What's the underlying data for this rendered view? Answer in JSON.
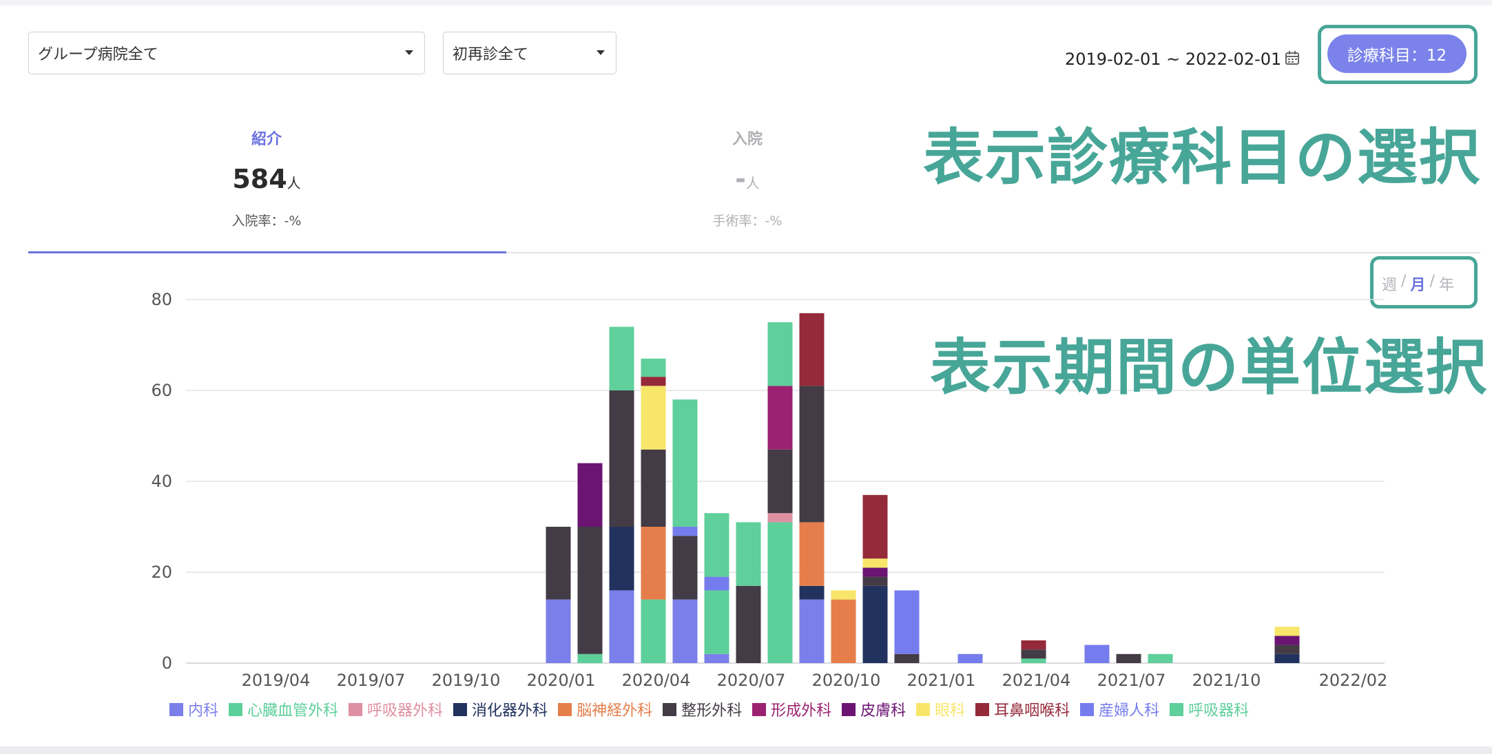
{
  "filters": {
    "hospital": "グループ病院全て",
    "visit_type": "初再診全て"
  },
  "date_range": "2019-02-01 ~ 2022-02-01",
  "dept_button": "診療科目：12",
  "annotations": {
    "dept_select": "表示診療科目の選択",
    "period_select": "表示期間の単位選択"
  },
  "stats": {
    "referral": {
      "label": "紹介",
      "value": "584",
      "unit": "人",
      "rate": "入院率：-%"
    },
    "admission": {
      "label": "入院",
      "value": "-",
      "unit": "人",
      "rate": "手術率：-%"
    }
  },
  "period_toggle": {
    "week": "週",
    "month": "月",
    "year": "年",
    "separator": "/",
    "active": "month"
  },
  "chart_data": {
    "type": "bar",
    "stacked": true,
    "ylim": [
      0,
      80
    ],
    "yticks": [
      0,
      20,
      40,
      60,
      80
    ],
    "grid": true,
    "legend_position": "bottom",
    "x_tick_labels": [
      "2019/04",
      "2019/07",
      "2019/10",
      "2020/01",
      "2020/04",
      "2020/07",
      "2020/10",
      "2021/01",
      "2021/04",
      "2021/07",
      "2021/10",
      "2022/02"
    ],
    "months": [
      "2019/02",
      "2019/03",
      "2019/04",
      "2019/05",
      "2019/06",
      "2019/07",
      "2019/08",
      "2019/09",
      "2019/10",
      "2019/11",
      "2019/12",
      "2020/01",
      "2020/02",
      "2020/03",
      "2020/04",
      "2020/05",
      "2020/06",
      "2020/07",
      "2020/08",
      "2020/09",
      "2020/10",
      "2020/11",
      "2020/12",
      "2021/01",
      "2021/02",
      "2021/03",
      "2021/04",
      "2021/05",
      "2021/06",
      "2021/07",
      "2021/08",
      "2021/09",
      "2021/10",
      "2021/11",
      "2021/12",
      "2022/01",
      "2022/02"
    ],
    "series": [
      {
        "name": "内科",
        "color": "#7b7fea",
        "values": [
          0,
          0,
          0,
          0,
          0,
          0,
          0,
          0,
          0,
          0,
          0,
          14,
          0,
          16,
          0,
          14,
          2,
          0,
          0,
          14,
          0,
          0,
          0,
          0,
          0,
          0,
          0,
          0,
          0,
          0,
          0,
          0,
          0,
          0,
          0,
          0,
          0
        ]
      },
      {
        "name": "心臓血管外科",
        "color": "#5ccf9a",
        "values": [
          0,
          0,
          0,
          0,
          0,
          0,
          0,
          0,
          0,
          0,
          0,
          0,
          2,
          0,
          14,
          0,
          14,
          0,
          31,
          0,
          0,
          0,
          0,
          0,
          0,
          0,
          1,
          0,
          0,
          0,
          0,
          0,
          0,
          0,
          0,
          0,
          0
        ]
      },
      {
        "name": "呼吸器外科",
        "color": "#df8fa2",
        "values": [
          0,
          0,
          0,
          0,
          0,
          0,
          0,
          0,
          0,
          0,
          0,
          0,
          0,
          0,
          0,
          0,
          0,
          0,
          2,
          0,
          0,
          0,
          0,
          0,
          0,
          0,
          0,
          0,
          0,
          0,
          0,
          0,
          0,
          0,
          0,
          0,
          0
        ]
      },
      {
        "name": "消化器外科",
        "color": "#22325e",
        "values": [
          0,
          0,
          0,
          0,
          0,
          0,
          0,
          0,
          0,
          0,
          0,
          0,
          0,
          14,
          0,
          0,
          0,
          0,
          0,
          3,
          0,
          17,
          0,
          0,
          0,
          0,
          0,
          0,
          0,
          0,
          0,
          0,
          0,
          0,
          2,
          0,
          0
        ]
      },
      {
        "name": "脳神経外科",
        "color": "#e57e4a",
        "values": [
          0,
          0,
          0,
          0,
          0,
          0,
          0,
          0,
          0,
          0,
          0,
          0,
          0,
          0,
          16,
          0,
          0,
          0,
          0,
          14,
          14,
          0,
          0,
          0,
          0,
          0,
          0,
          0,
          0,
          0,
          0,
          0,
          0,
          0,
          0,
          0,
          0
        ]
      },
      {
        "name": "整形外科",
        "color": "#433b45",
        "values": [
          0,
          0,
          0,
          0,
          0,
          0,
          0,
          0,
          0,
          0,
          0,
          16,
          28,
          30,
          17,
          14,
          0,
          17,
          14,
          30,
          0,
          2,
          2,
          0,
          0,
          0,
          2,
          0,
          0,
          2,
          0,
          0,
          0,
          0,
          2,
          0,
          0
        ]
      },
      {
        "name": "形成外科",
        "color": "#9b2270",
        "values": [
          0,
          0,
          0,
          0,
          0,
          0,
          0,
          0,
          0,
          0,
          0,
          0,
          0,
          0,
          0,
          0,
          0,
          0,
          14,
          0,
          0,
          0,
          0,
          0,
          0,
          0,
          0,
          0,
          0,
          0,
          0,
          0,
          0,
          0,
          0,
          0,
          0
        ]
      },
      {
        "name": "皮膚科",
        "color": "#6b1472",
        "values": [
          0,
          0,
          0,
          0,
          0,
          0,
          0,
          0,
          0,
          0,
          0,
          0,
          14,
          0,
          0,
          0,
          0,
          0,
          0,
          0,
          0,
          2,
          0,
          0,
          0,
          0,
          0,
          0,
          0,
          0,
          0,
          0,
          0,
          0,
          2,
          0,
          0
        ]
      },
      {
        "name": "眼科",
        "color": "#f7e66a",
        "values": [
          0,
          0,
          0,
          0,
          0,
          0,
          0,
          0,
          0,
          0,
          0,
          0,
          0,
          0,
          14,
          0,
          0,
          0,
          0,
          0,
          2,
          2,
          0,
          0,
          0,
          0,
          0,
          0,
          0,
          0,
          0,
          0,
          0,
          0,
          2,
          0,
          0
        ]
      },
      {
        "name": "耳鼻咽喉科",
        "color": "#952a3a",
        "values": [
          0,
          0,
          0,
          0,
          0,
          0,
          0,
          0,
          0,
          0,
          0,
          0,
          0,
          0,
          2,
          0,
          0,
          0,
          0,
          16,
          0,
          14,
          0,
          0,
          0,
          0,
          2,
          0,
          0,
          0,
          0,
          0,
          0,
          0,
          0,
          0,
          0
        ]
      },
      {
        "name": "産婦人科",
        "color": "#757ced",
        "values": [
          0,
          0,
          0,
          0,
          0,
          0,
          0,
          0,
          0,
          0,
          0,
          0,
          0,
          0,
          0,
          2,
          3,
          0,
          0,
          0,
          0,
          0,
          14,
          0,
          2,
          0,
          0,
          0,
          4,
          0,
          0,
          0,
          0,
          0,
          0,
          0,
          0
        ]
      },
      {
        "name": "呼吸器科",
        "color": "#5fcf9b",
        "values": [
          0,
          0,
          0,
          0,
          0,
          0,
          0,
          0,
          0,
          0,
          0,
          0,
          0,
          14,
          4,
          28,
          14,
          14,
          14,
          0,
          0,
          0,
          0,
          0,
          0,
          0,
          0,
          0,
          0,
          0,
          2,
          0,
          0,
          0,
          0,
          0,
          0
        ]
      }
    ]
  },
  "colors": {
    "accent": "#6b72e0",
    "annotation": "#47a698"
  }
}
